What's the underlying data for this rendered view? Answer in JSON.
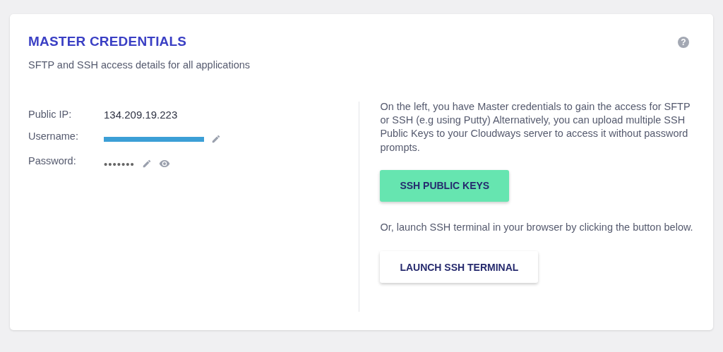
{
  "card": {
    "title": "MASTER CREDENTIALS",
    "subtitle": "SFTP and SSH access details for all applications",
    "help_icon": "?"
  },
  "credentials": [
    {
      "label": "Public IP:",
      "value": "134.209.19.223",
      "kind": "text",
      "editable": false,
      "revealable": false
    },
    {
      "label": "Username:",
      "kind": "redacted",
      "editable": true,
      "revealable": false
    },
    {
      "label": "Password:",
      "value": "•••••••",
      "kind": "password",
      "editable": true,
      "revealable": true
    }
  ],
  "info": {
    "description": "On the left, you have Master credentials to gain the access for SFTP or SSH (e.g using Putty) Alternatively, you can upload multiple SSH Public Keys to your Cloudways server to access it without password prompts.",
    "keys_button": "SSH PUBLIC KEYS",
    "terminal_text": "Or, launch SSH terminal in your browser by clicking the button below.",
    "terminal_button": "LAUNCH SSH TERMINAL"
  }
}
